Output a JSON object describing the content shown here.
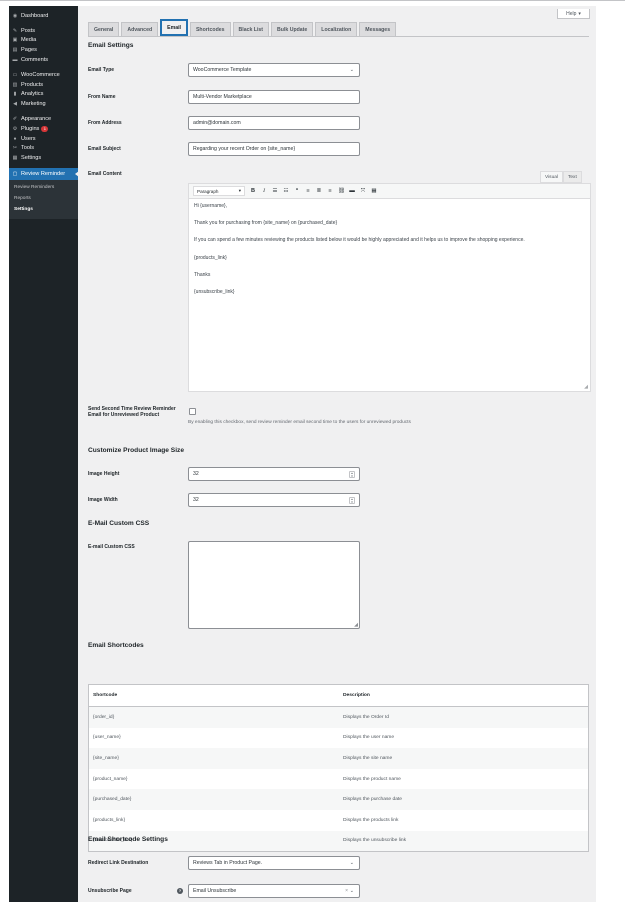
{
  "sidebar": {
    "items": [
      {
        "label": "Dashboard",
        "icon": "dashboard-icon",
        "glyph": "◉"
      },
      {
        "label": "Posts",
        "icon": "pin-icon",
        "glyph": "✎"
      },
      {
        "label": "Media",
        "icon": "media-icon",
        "glyph": "▣"
      },
      {
        "label": "Pages",
        "icon": "pages-icon",
        "glyph": "▤"
      },
      {
        "label": "Comments",
        "icon": "comments-icon",
        "glyph": "▬"
      },
      {
        "label": "WooCommerce",
        "icon": "woocommerce-icon",
        "glyph": "▭"
      },
      {
        "label": "Products",
        "icon": "products-icon",
        "glyph": "▥"
      },
      {
        "label": "Analytics",
        "icon": "analytics-icon",
        "glyph": "▮"
      },
      {
        "label": "Marketing",
        "icon": "marketing-icon",
        "glyph": "◀"
      },
      {
        "label": "Appearance",
        "icon": "appearance-icon",
        "glyph": "✐"
      },
      {
        "label": "Plugins",
        "icon": "plugins-icon",
        "glyph": "⚙",
        "badge": "1"
      },
      {
        "label": "Users",
        "icon": "users-icon",
        "glyph": "●"
      },
      {
        "label": "Tools",
        "icon": "tools-icon",
        "glyph": "✂"
      },
      {
        "label": "Settings",
        "icon": "settings-icon",
        "glyph": "▦"
      }
    ],
    "active": {
      "label": "Review Reminder",
      "icon": "review-reminder-icon",
      "glyph": "▢"
    },
    "submenu": [
      "Review Reminders",
      "Reports",
      "Settings"
    ]
  },
  "help_label": "Help",
  "tabs": [
    "General",
    "Advanced",
    "Email",
    "Shortcodes",
    "Black List",
    "Bulk Update",
    "Localization",
    "Messages"
  ],
  "active_tab": "Email",
  "email_settings": {
    "heading": "Email Settings",
    "email_type_label": "Email Type",
    "email_type_value": "WooCommerce Template",
    "from_name_label": "From Name",
    "from_name_value": "Multi-Vendor Marketplace",
    "from_address_label": "From Address",
    "from_address_value": "admin@domain.com",
    "email_subject_label": "Email Subject",
    "email_subject_value": "Regarding your recent Order on {site_name}",
    "email_content_label": "Email Content"
  },
  "editor": {
    "tab_visual": "Visual",
    "tab_text": "Text",
    "format_select": "Paragraph",
    "paragraphs": [
      "Hi {username},",
      "Thank you for purchasing from {site_name} on {purchased_date}",
      "If you can spend a few minutes reviewing the products listed below it would be highly appreciated and it helps us to improve the shopping experience.",
      "{products_link}",
      "Thanks",
      "{unsubscribe_link}"
    ]
  },
  "second_time": {
    "label": "Send Second Time Review Reminder Email for Unreviewed Product",
    "description": "By enabling this checkbox, send review reminder email second time to the users for unreviewed products",
    "checked": false
  },
  "image_size": {
    "heading": "Customize Product Image Size",
    "height_label": "Image Height",
    "height_value": "32",
    "width_label": "Image Width",
    "width_value": "32"
  },
  "custom_css": {
    "heading": "E-Mail Custom CSS",
    "label": "E-mail Custom CSS"
  },
  "shortcodes": {
    "heading": "Email Shortcodes",
    "col_shortcode": "Shortcode",
    "col_description": "Description",
    "rows": [
      {
        "code": "{order_id}",
        "desc": "Displays the Order Id"
      },
      {
        "code": "{user_name}",
        "desc": "Displays the user name"
      },
      {
        "code": "{site_name}",
        "desc": "Displays the site name"
      },
      {
        "code": "{product_name}",
        "desc": "Displays the product name"
      },
      {
        "code": "{purchased_date}",
        "desc": "Displays the purchase date"
      },
      {
        "code": "{products_link}",
        "desc": "Displays the products link"
      },
      {
        "code": "{unsubscribe_link}",
        "desc": "Displays the unsubscribe link"
      }
    ]
  },
  "shortcode_settings": {
    "heading": "Email Shortcode Settings",
    "redirect_label": "Redirect Link Destination",
    "redirect_value": "Reviews Tab in Product Page.",
    "unsubscribe_label": "Unsubscribe Page",
    "unsubscribe_value": "Email Unsubscribe",
    "unsubscribe_clear": "×"
  }
}
